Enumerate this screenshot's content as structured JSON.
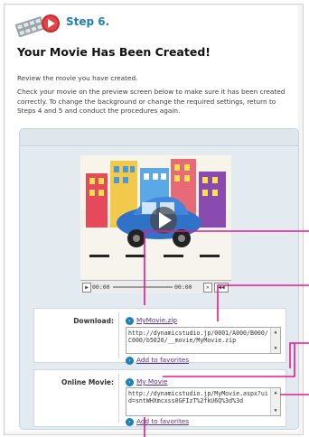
{
  "header": {
    "step_title": "Step 6.",
    "icon": "film-play-icon"
  },
  "page_heading": "Your Movie Has Been Created!",
  "intro": {
    "line1": "Review the movie you have created.",
    "line2": "Check your movie on the preview screen below to make sure it has been created correctly. To change the background or change the required settings, return to Steps 4 and 5 and conduct the procedures again."
  },
  "player": {
    "time_current": "00:00",
    "time_total": "00:00",
    "play_icon": "play-icon",
    "fullscreen_icon": "expand-icon",
    "volume_icon": "volume-icon"
  },
  "download": {
    "label": "Download:",
    "link": "MyMovie.zip",
    "url": "http://dynamicstudio.jp/0001/A000/B000/C000/b5026/__movie/MyMovie.zip",
    "favorites": "Add to favorites"
  },
  "online": {
    "label": "Online Movie:",
    "link": "My Movie",
    "url": "http://dynamicstudio.jp/MyMovie.aspx?uid=sntWHXmcxss0GFIzT%2fkU6Q%3d%3d",
    "favorites": "Add to favorites"
  },
  "colors": {
    "accent": "#1f7fb8",
    "callout": "#e8198b",
    "link": "#5a2d8c",
    "panel": "#e4ebf0"
  }
}
